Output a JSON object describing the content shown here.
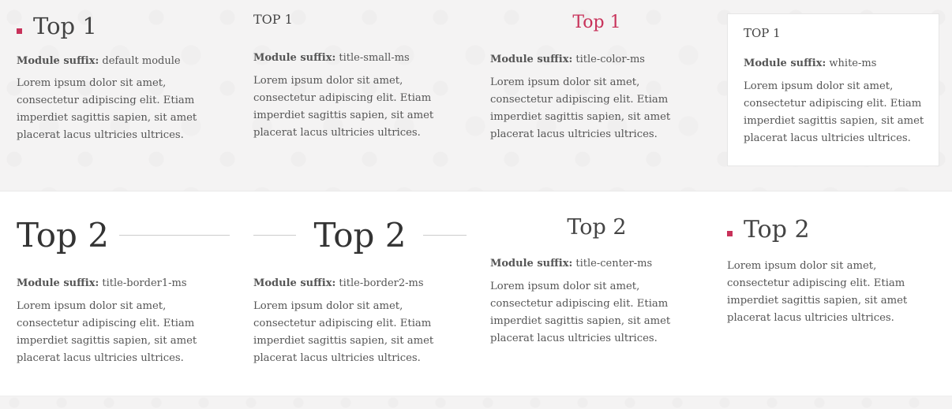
{
  "suffix_label": "Module suffix:",
  "lorem": "Lorem ipsum dolor sit amet, consectetur adipiscing elit. Etiam imperdiet sagittis sapien, sit amet placerat lacus ultricies ultrices.",
  "accent_color": "#c8325a",
  "top1": [
    {
      "title": "Top 1",
      "suffix": "default module"
    },
    {
      "title": "TOP 1",
      "suffix": "title-small-ms"
    },
    {
      "title": "Top 1",
      "suffix": "title-color-ms"
    },
    {
      "title": "TOP 1",
      "suffix": "white-ms"
    }
  ],
  "top2": [
    {
      "title": "Top 2",
      "suffix": "title-border1-ms"
    },
    {
      "title": "Top 2",
      "suffix": "title-border2-ms"
    },
    {
      "title": "Top 2",
      "suffix": "title-center-ms"
    },
    {
      "title": "Top 2",
      "suffix": ""
    }
  ]
}
